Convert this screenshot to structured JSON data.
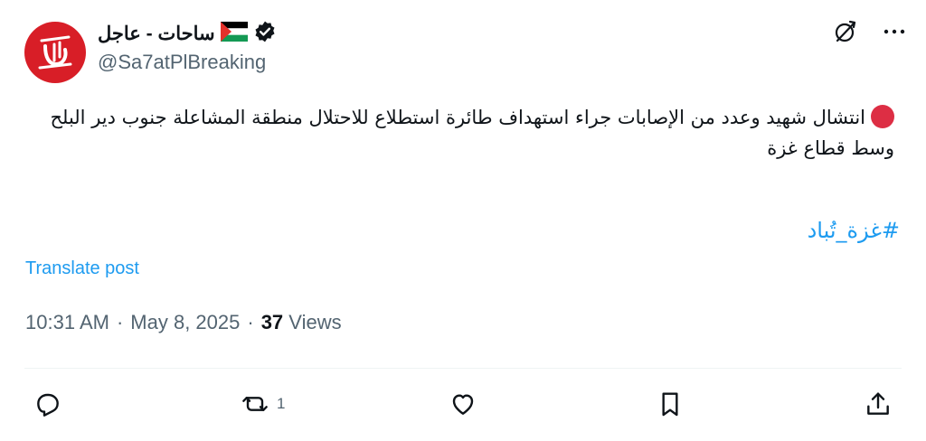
{
  "author": {
    "display_name": "ساحات - عاجل",
    "handle": "@Sa7atPlBreaking",
    "flag_emoji_name": "palestine-flag",
    "verified": true,
    "avatar_color": "#d81e27"
  },
  "post": {
    "text": "انتشال شهيد وعدد من الإصابات جراء استهداف طائرة استطلاع للاحتلال منطقة المشاعلة جنوب دير البلح وسط قطاع غزة",
    "hashtag": "#غزة_تُباد",
    "translate_label": "Translate post",
    "time": "10:31 AM",
    "separator": "·",
    "date": "May 8, 2025",
    "views_count": "37",
    "views_label": "Views"
  },
  "actions": {
    "reposts_count": "1"
  },
  "colors": {
    "link": "#1d9bf0",
    "muted": "#536471",
    "text": "#0f1419"
  }
}
